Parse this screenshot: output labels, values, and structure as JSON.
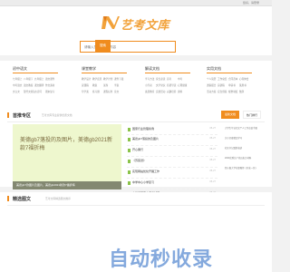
{
  "topbar": {
    "login": "您好，请登录"
  },
  "header": {
    "site_name": "艺考文库"
  },
  "search": {
    "placeholder": "请输入您想搜索的内容",
    "button": "搜索"
  },
  "categories": [
    {
      "title": "初中语文",
      "items": [
        "七年级上",
        "八年级下",
        "九年级上",
        "语文课件",
        "中考语文",
        "语文教案",
        "课文翻译",
        "作文素材",
        "文言文",
        "现代文阅读",
        "古诗词",
        "期末复习"
      ]
    },
    {
      "title": "课堂教学",
      "items": [
        "教学设计",
        "教学反思",
        "教学计划",
        "课件下载",
        "说课稿",
        "教案",
        "试卷",
        "学案",
        "导学案",
        "练习题",
        "课程标准",
        "论文"
      ]
    },
    {
      "title": "解读文档",
      "items": [
        "学习方法",
        "家长必读",
        "高考",
        "中考",
        "小升初",
        "文学常识",
        "名著导读",
        "心理健康",
        "素质教育",
        "实践活动",
        "兴趣培养",
        "资料"
      ]
    },
    {
      "title": "实用文档",
      "items": [
        "个人简历",
        "工作总结",
        "合同范本",
        "心得体会",
        "述职报告",
        "演讲稿",
        "申请书",
        "策划书",
        "活动方案",
        "应急预案",
        "规章制度",
        "致辞"
      ]
    }
  ],
  "featured": {
    "title": "首推专区",
    "subtitle": "艺考文库专业提供优质文档",
    "image_text": "美德gb7落投的及图片，美德gb2021新款7福折梅",
    "caption": "美德gb7款图片及图片，美德gb2021新款7福折梅"
  },
  "docs": [
    {
      "title": "国家行业管理条例",
      "date": "05-27"
    },
    {
      "title": "美德gb7落投的及图片",
      "date": "05-27"
    },
    {
      "title": "开心果行",
      "date": "05-27"
    },
    {
      "title": "《苏菜谱》",
      "date": "05-27"
    },
    {
      "title": "实现网站优化开展工作",
      "date": "05-27"
    },
    {
      "title": "中学中心小学复习",
      "date": "05-27"
    },
    {
      "title": "中华与国家文汽考试题",
      "date": "05-27"
    },
    {
      "title": "春联语大赏析",
      "date": "05-27"
    }
  ],
  "right": {
    "tab_active": "最新文档",
    "tab_other": "热门排行",
    "items": [
      "大学生毕业论文个人工作总结手稿",
      "关于全省精品学习",
      "社区书记致辞演讲",
      "2024优秀共产党员发言材料",
      "四川省大学在职教师《开发一区》"
    ]
  },
  "section2": {
    "title": "精选图文",
    "subtitle": "艺考文库精选图文推荐"
  },
  "watermark": "自动秒收录"
}
